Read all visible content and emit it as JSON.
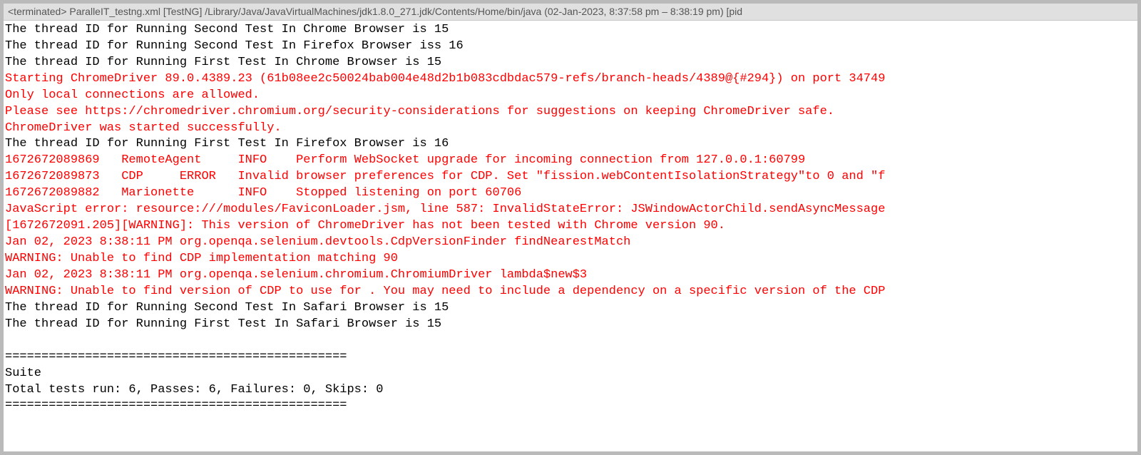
{
  "header": {
    "text": "<terminated> ParalleIT_testng.xml [TestNG] /Library/Java/JavaVirtualMachines/jdk1.8.0_271.jdk/Contents/Home/bin/java  (02-Jan-2023, 8:37:58 pm – 8:38:19 pm) [pid"
  },
  "lines": [
    {
      "k": "out",
      "t": "The thread ID for Running Second Test In Chrome Browser is 15"
    },
    {
      "k": "out",
      "t": "The thread ID for Running Second Test In Firefox Browser iss 16"
    },
    {
      "k": "out",
      "t": "The thread ID for Running First Test In Chrome Browser is 15"
    },
    {
      "k": "err",
      "t": "Starting ChromeDriver 89.0.4389.23 (61b08ee2c50024bab004e48d2b1b083cdbdac579-refs/branch-heads/4389@{#294}) on port 34749"
    },
    {
      "k": "err",
      "t": "Only local connections are allowed."
    },
    {
      "k": "err",
      "t": "Please see https://chromedriver.chromium.org/security-considerations for suggestions on keeping ChromeDriver safe."
    },
    {
      "k": "err",
      "t": "ChromeDriver was started successfully."
    },
    {
      "k": "out",
      "t": "The thread ID for Running First Test In Firefox Browser is 16"
    },
    {
      "k": "err",
      "t": "1672672089869   RemoteAgent     INFO    Perform WebSocket upgrade for incoming connection from 127.0.0.1:60799"
    },
    {
      "k": "err",
      "t": "1672672089873   CDP     ERROR   Invalid browser preferences for CDP. Set \"fission.webContentIsolationStrategy\"to 0 and \"f"
    },
    {
      "k": "err",
      "t": "1672672089882   Marionette      INFO    Stopped listening on port 60706"
    },
    {
      "k": "err",
      "t": "JavaScript error: resource:///modules/FaviconLoader.jsm, line 587: InvalidStateError: JSWindowActorChild.sendAsyncMessage"
    },
    {
      "k": "err",
      "t": "[1672672091.205][WARNING]: This version of ChromeDriver has not been tested with Chrome version 90."
    },
    {
      "k": "err",
      "t": "Jan 02, 2023 8:38:11 PM org.openqa.selenium.devtools.CdpVersionFinder findNearestMatch"
    },
    {
      "k": "err",
      "t": "WARNING: Unable to find CDP implementation matching 90"
    },
    {
      "k": "err",
      "t": "Jan 02, 2023 8:38:11 PM org.openqa.selenium.chromium.ChromiumDriver lambda$new$3"
    },
    {
      "k": "err",
      "t": "WARNING: Unable to find version of CDP to use for . You may need to include a dependency on a specific version of the CDP"
    },
    {
      "k": "out",
      "t": "The thread ID for Running Second Test In Safari Browser is 15"
    },
    {
      "k": "out",
      "t": "The thread ID for Running First Test In Safari Browser is 15"
    },
    {
      "k": "blank",
      "t": ""
    },
    {
      "k": "out",
      "t": "==============================================="
    },
    {
      "k": "out",
      "t": "Suite"
    },
    {
      "k": "out",
      "t": "Total tests run: 6, Passes: 6, Failures: 0, Skips: 0"
    },
    {
      "k": "out",
      "t": "==============================================="
    }
  ]
}
